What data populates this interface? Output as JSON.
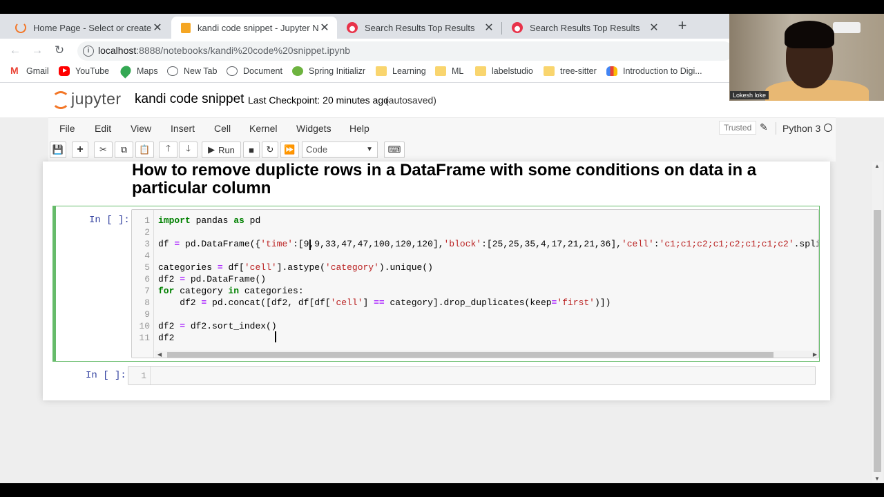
{
  "browser": {
    "tabs": [
      {
        "title": "Home Page - Select or create a n",
        "icon": "jupyter-icon"
      },
      {
        "title": "kandi code snippet - Jupyter Not",
        "icon": "notebook-icon"
      },
      {
        "title": "Search Results Top Results",
        "icon": "search-results-icon"
      },
      {
        "title": "Search Results Top Results",
        "icon": "search-results-icon"
      }
    ],
    "url_host": "localhost",
    "url_path": ":8888/notebooks/kandi%20code%20snippet.ipynb",
    "bookmarks": [
      "Gmail",
      "YouTube",
      "Maps",
      "New Tab",
      "Document",
      "Spring Initializr",
      "Learning",
      "ML",
      "labelstudio",
      "tree-sitter",
      "Introduction to Digi..."
    ]
  },
  "jupyter": {
    "logo_text": "jupyter",
    "notebook_name": "kandi code snippet",
    "checkpoint": "Last Checkpoint: 20 minutes ago",
    "autosaved": "(autosaved)",
    "menu": [
      "File",
      "Edit",
      "View",
      "Insert",
      "Cell",
      "Kernel",
      "Widgets",
      "Help"
    ],
    "trusted": "Trusted",
    "kernel": "Python 3",
    "run_label": "Run",
    "cell_type": "Code"
  },
  "notebook": {
    "heading": "How to remove duplicte rows in a DataFrame with some conditions on data in a particular column",
    "cell1_prompt": "In [ ]:",
    "cell2_prompt": "In [ ]:",
    "cell2_line_number": "1",
    "lines": [
      "1",
      "2",
      "3",
      "4",
      "5",
      "6",
      "7",
      "8",
      "9",
      "10",
      "11"
    ]
  },
  "webcam": {
    "name_label": "Lokesh loke"
  },
  "colors": {
    "active_cell_border": "#66bb6a",
    "prompt": "#303f9f",
    "keyword": "#008000",
    "string": "#ba2121",
    "jupyter_orange": "#f37626"
  }
}
